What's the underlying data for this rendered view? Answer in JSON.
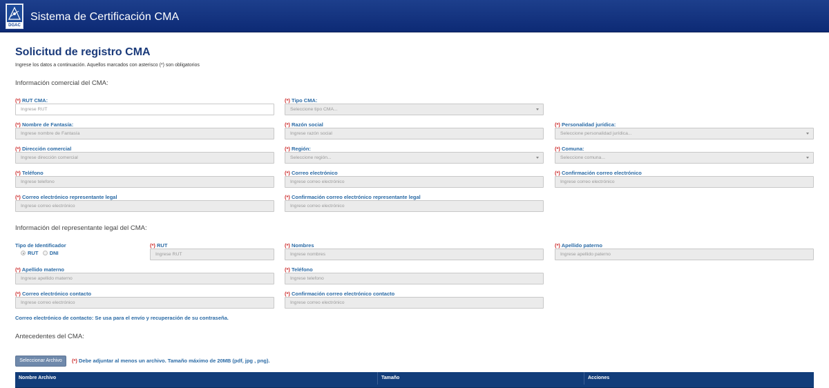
{
  "header": {
    "logo_text": "DGAC",
    "title": "Sistema de Certificación CMA"
  },
  "page": {
    "title": "Solicitud de registro CMA",
    "subtitle": "Ingrese los datos a continuación. Aquellos marcados con asterisco (*) son obligatorios"
  },
  "sections": {
    "commercial": "Información comercial del CMA:",
    "legal_rep": "Información del representante legal del CMA:",
    "background": "Antecedentes del CMA:"
  },
  "required_mark": "(*)",
  "commercial_fields": {
    "rut_cma": {
      "label": "RUT CMA:",
      "placeholder": "Ingrese RUT"
    },
    "tipo_cma": {
      "label": "Tipo CMA:",
      "placeholder": "Seleccione tipo CMA..."
    },
    "nombre_fantasia": {
      "label": "Nombre de Fantasía:",
      "placeholder": "Ingrese nombre de Fantasía"
    },
    "razon_social": {
      "label": "Razón social",
      "placeholder": "Ingrese razón social"
    },
    "personalidad_juridica": {
      "label": "Personalidad jurídica:",
      "placeholder": "Seleccione personalidad jurídica..."
    },
    "direccion_comercial": {
      "label": "Dirección comercial",
      "placeholder": "Ingrese dirección comercial"
    },
    "region": {
      "label": "Región:",
      "placeholder": "Seleccione región..."
    },
    "comuna": {
      "label": "Comuna:",
      "placeholder": "Seleccione comuna..."
    },
    "telefono": {
      "label": "Teléfono",
      "placeholder": "Ingrese telefono"
    },
    "correo": {
      "label": "Correo electrónico",
      "placeholder": "Ingrese correo electrónico"
    },
    "confirmacion_correo": {
      "label": "Confirmación correo electrónico",
      "placeholder": "Ingrese correo electrónico"
    },
    "correo_rep_legal": {
      "label": "Correo electrónico representante legal",
      "placeholder": "Ingrese correo electrónico"
    },
    "confirmacion_correo_rep_legal": {
      "label": "Confirmación correo electrónico representante legal",
      "placeholder": "Ingrese correo electrónico"
    }
  },
  "legal_fields": {
    "tipo_identificador": {
      "label": "Tipo de Identificador",
      "options": [
        "RUT",
        "DNI"
      ],
      "selected": "RUT"
    },
    "rut": {
      "label": "RUT",
      "placeholder": "Ingrese RUT"
    },
    "nombres": {
      "label": "Nombres",
      "placeholder": "Ingrese nombres"
    },
    "apellido_paterno": {
      "label": "Apellido paterno",
      "placeholder": "Ingrese apellido paterno"
    },
    "apellido_materno": {
      "label": "Apellido materno",
      "placeholder": "Ingrese apellido materno"
    },
    "telefono": {
      "label": "Teléfono",
      "placeholder": "Ingrese telefono"
    },
    "correo_contacto": {
      "label": "Correo electrónico contacto",
      "placeholder": "Ingrese correo electrónico"
    },
    "confirmacion_correo_contacto": {
      "label": "Confirmación correo electrónico contacto",
      "placeholder": "Ingrese correo electrónico"
    }
  },
  "contact_note": "Correo electrónico de contacto: Se usa para el envío y recuperación de su contraseña.",
  "upload": {
    "button_label": "Seleccionar Archivo",
    "note": "Debe adjuntar al menos un archivo. Tamaño máximo de 20MB (pdf, jpg , png)."
  },
  "files_table": {
    "columns": [
      "Nombre Archivo",
      "Tamaño",
      "Acciones"
    ]
  }
}
